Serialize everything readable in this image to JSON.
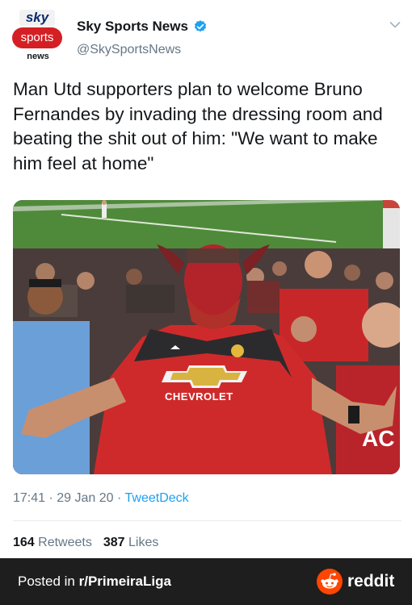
{
  "tweet": {
    "avatar": {
      "line1": "sky",
      "line2": "sports",
      "line3": "news"
    },
    "display_name": "Sky Sports News",
    "handle": "@SkySportsNews",
    "text": "Man Utd supporters plan to welcome Bruno Fernandes by invading the dressing room and beating the shit out of him: \"We want to make him feel at home\"",
    "media": {
      "icon": "photo-image",
      "shirt_sponsor": "CHEVROLET",
      "corner_text": "AC"
    },
    "time": "17:41",
    "date": "29 Jan 20",
    "separator": "·",
    "client": "TweetDeck",
    "retweets_count": "164",
    "retweets_label": "Retweets",
    "likes_count": "387",
    "likes_label": "Likes"
  },
  "footer": {
    "posted_prefix": "Posted in ",
    "subreddit": "r/PrimeiraLiga",
    "brand": "reddit"
  },
  "colors": {
    "link": "#1da1f2",
    "muted": "#657786",
    "footer_bg": "#1e1e1e",
    "reddit_orange": "#ff4500",
    "verified": "#1da1f2"
  }
}
